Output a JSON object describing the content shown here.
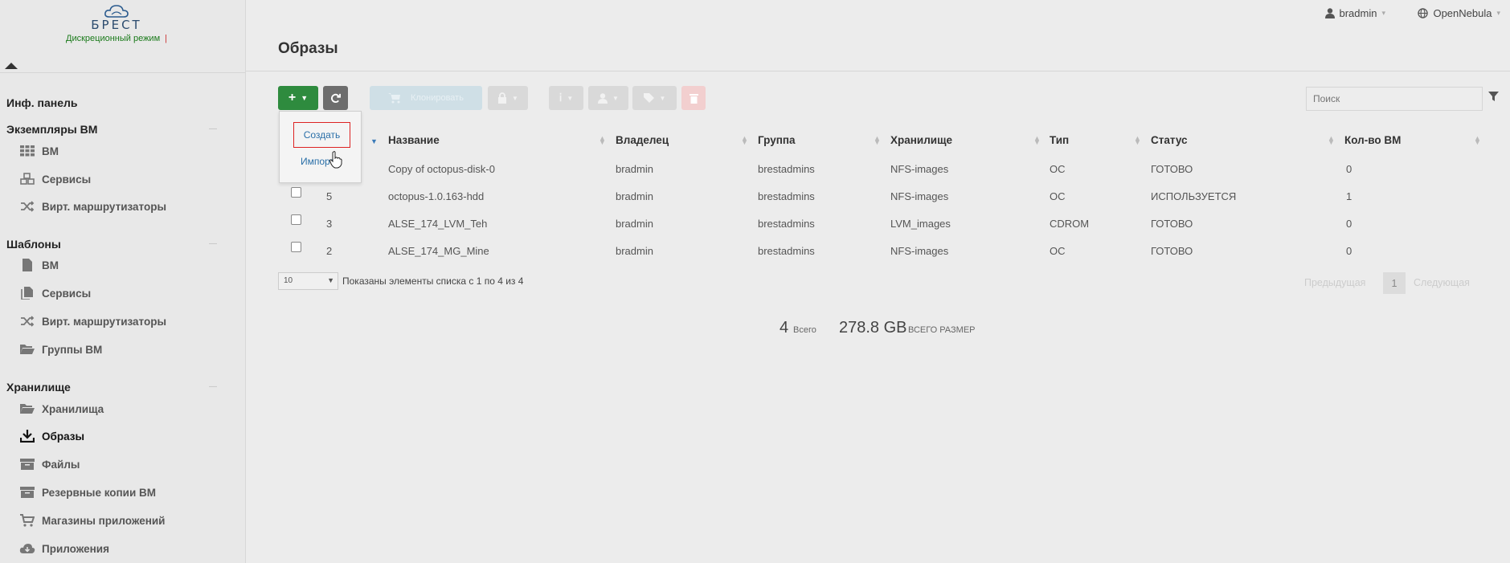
{
  "logo": {
    "name": "БРЕСТ",
    "mode": "Дискреционный режим",
    "mode_mark": "|"
  },
  "sidebar": {
    "sections": [
      {
        "label": "Инф. панель"
      },
      {
        "label": "Экземпляры ВМ"
      },
      {
        "label": "Шаблоны"
      },
      {
        "label": "Хранилище"
      }
    ],
    "items": [
      {
        "label": "ВМ"
      },
      {
        "label": "Сервисы"
      },
      {
        "label": "Вирт. маршрутизаторы"
      },
      {
        "label": "ВМ"
      },
      {
        "label": "Сервисы"
      },
      {
        "label": "Вирт. маршрутизаторы"
      },
      {
        "label": "Группы ВМ"
      },
      {
        "label": "Хранилища"
      },
      {
        "label": "Образы"
      },
      {
        "label": "Файлы"
      },
      {
        "label": "Резервные копии ВМ"
      },
      {
        "label": "Магазины приложений"
      },
      {
        "label": "Приложения"
      }
    ]
  },
  "topbar": {
    "user": "bradmin",
    "cloud": "OpenNebula"
  },
  "page": {
    "title": "Образы"
  },
  "toolbar": {
    "add": "+",
    "clone": "Клонировать",
    "search_placeholder": "Поиск"
  },
  "dropdown": {
    "create": "Создать",
    "import": "Импорт"
  },
  "table": {
    "columns": [
      "Название",
      "Владелец",
      "Группа",
      "Хранилище",
      "Тип",
      "Статус",
      "Кол-во ВМ"
    ],
    "rows": [
      {
        "id": "",
        "name": "Copy of octopus-disk-0",
        "owner": "bradmin",
        "group": "brestadmins",
        "datastore": "NFS-images",
        "type": "ОС",
        "status": "ГОТОВО",
        "vms": "0"
      },
      {
        "id": "5",
        "name": "octopus-1.0.163-hdd",
        "owner": "bradmin",
        "group": "brestadmins",
        "datastore": "NFS-images",
        "type": "ОС",
        "status": "ИСПОЛЬЗУЕТСЯ",
        "vms": "1"
      },
      {
        "id": "3",
        "name": "ALSE_174_LVM_Teh",
        "owner": "bradmin",
        "group": "brestadmins",
        "datastore": "LVM_images",
        "type": "CDROM",
        "status": "ГОТОВО",
        "vms": "0"
      },
      {
        "id": "2",
        "name": "ALSE_174_MG_Mine",
        "owner": "bradmin",
        "group": "brestadmins",
        "datastore": "NFS-images",
        "type": "ОС",
        "status": "ГОТОВО",
        "vms": "0"
      }
    ]
  },
  "pagination": {
    "page_size": "10",
    "shown_text": "Показаны элементы списка с 1 по 4 из 4",
    "prev": "Предыдущая",
    "current": "1",
    "next": "Следующая"
  },
  "stats": {
    "total_num": "4",
    "total_label": "Всего",
    "size_num": "278.8 GB",
    "size_label": "ВСЕГО РАЗМЕР"
  }
}
